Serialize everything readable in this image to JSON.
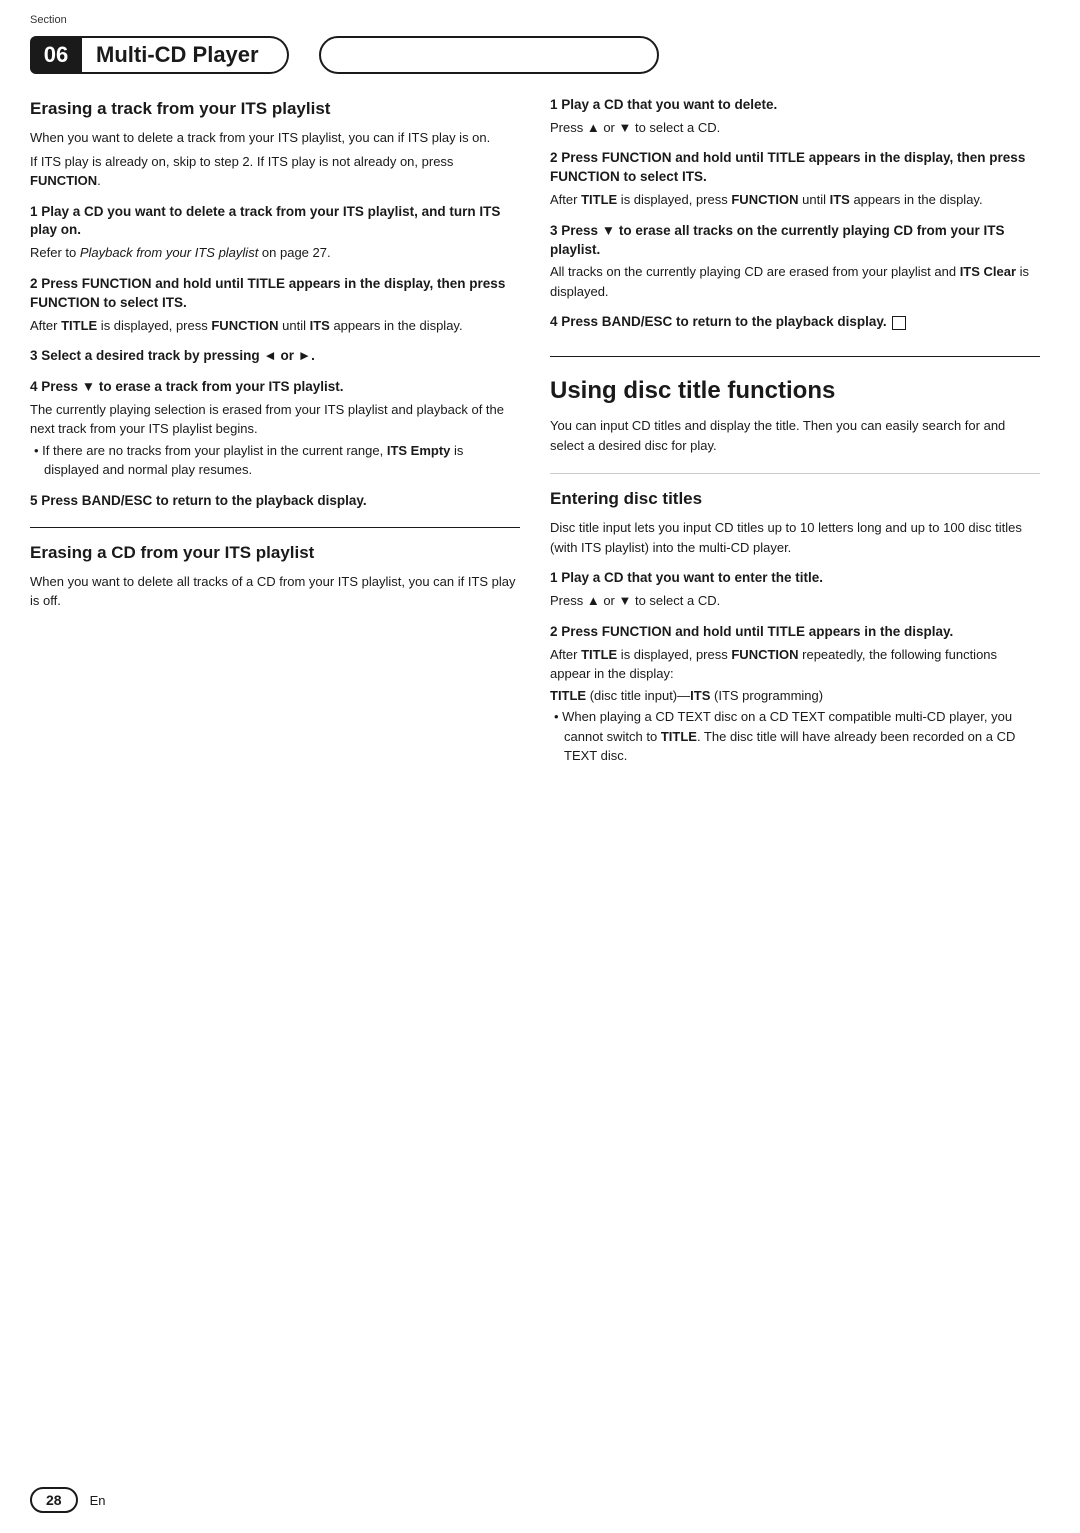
{
  "header": {
    "section_label": "Section",
    "section_number": "06",
    "section_title": "Multi-CD Player",
    "right_box_empty": true
  },
  "page_number": "28",
  "en_label": "En",
  "left_column": {
    "section1_heading": "Erasing a track from your ITS playlist",
    "section1_intro": "When you want to delete a track from your ITS playlist, you can if ITS play is on.",
    "section1_intro2": "If ITS play is already on, skip to step 2. If ITS play is not already on, press ",
    "section1_intro2_bold": "FUNCTION",
    "section1_intro2_end": ".",
    "step1_heading": "1  Play a CD you want to delete a track from your ITS playlist, and turn ITS play on.",
    "step1_body": "Refer to ",
    "step1_body_italic": "Playback from your ITS playlist",
    "step1_body2": " on page 27.",
    "step2_heading": "2  Press FUNCTION and hold until TITLE appears in the display, then press FUNCTION to select ITS.",
    "step2_body_pre": "After ",
    "step2_body_bold1": "TITLE",
    "step2_body_mid": " is displayed, press ",
    "step2_body_bold2": "FUNCTION",
    "step2_body_mid2": " until ",
    "step2_body_bold3": "ITS",
    "step2_body_end": " appears in the display.",
    "step3_heading": "3  Select a desired track by pressing ◄ or ►.",
    "step4_heading": "4  Press ▼ to erase a track from your ITS playlist.",
    "step4_body1": "The currently playing selection is erased from your ITS playlist and playback of the next track from your ITS playlist begins.",
    "step4_bullet": "• If there are no tracks from your playlist in the current range, ",
    "step4_bullet_bold": "ITS Empty",
    "step4_bullet_end": " is displayed and normal play resumes.",
    "step5_heading": "5  Press BAND/ESC to return to the playback display.",
    "section2_heading": "Erasing a CD from your ITS playlist",
    "section2_intro": "When you want to delete all tracks of a CD from your ITS playlist, you can if ITS play is off."
  },
  "right_column": {
    "step1_heading": "1  Play a CD that you want to delete.",
    "step1_body": "Press ▲ or ▼ to select a CD.",
    "step2_heading": "2  Press FUNCTION and hold until TITLE appears in the display, then press FUNCTION to select ITS.",
    "step2_body_pre": "After ",
    "step2_body_bold1": "TITLE",
    "step2_body_mid": " is displayed, press ",
    "step2_body_bold2": "FUNCTION",
    "step2_body_mid2": " until ",
    "step2_body_bold3": "ITS",
    "step2_body_end": " appears in the display.",
    "step3_heading": "3  Press ▼ to erase all tracks on the currently playing CD from your ITS playlist.",
    "step3_body_pre": "All tracks on the currently playing CD are erased from your playlist and ",
    "step3_body_bold": "ITS Clear",
    "step3_body_end": " is displayed.",
    "step4_heading": "4  Press BAND/ESC to return to the playback display.",
    "step4_icon": "■",
    "large_section_heading": "Using disc title functions",
    "large_section_intro": "You can input CD titles and display the title. Then you can easily search for and select a desired disc for play.",
    "subsection_heading": "Entering disc titles",
    "subsection_intro": "Disc title input lets you input CD titles up to 10 letters long and up to 100 disc titles (with ITS playlist) into the multi-CD player.",
    "sub_step1_heading": "1  Play a CD that you want to enter the title.",
    "sub_step1_body": "Press ▲ or ▼ to select a CD.",
    "sub_step2_heading": "2  Press FUNCTION and hold until TITLE appears in the display.",
    "sub_step2_body_pre": "After ",
    "sub_step2_body_bold1": "TITLE",
    "sub_step2_body_mid": " is displayed, press ",
    "sub_step2_body_bold2": "FUNCTION",
    "sub_step2_body_end": " repeatedly, the following functions appear in the display:",
    "sub_step2_bold_line_bold1": "TITLE",
    "sub_step2_bold_line_mid": " (disc title input)—",
    "sub_step2_bold_line_bold2": "ITS",
    "sub_step2_bold_line_end": " (ITS programming)",
    "sub_step2_bullet": "• When playing a CD TEXT disc on a CD TEXT compatible multi-CD player, you cannot switch to ",
    "sub_step2_bullet_bold": "TITLE",
    "sub_step2_bullet_end": ". The disc title will have already been recorded on a CD TEXT disc."
  }
}
